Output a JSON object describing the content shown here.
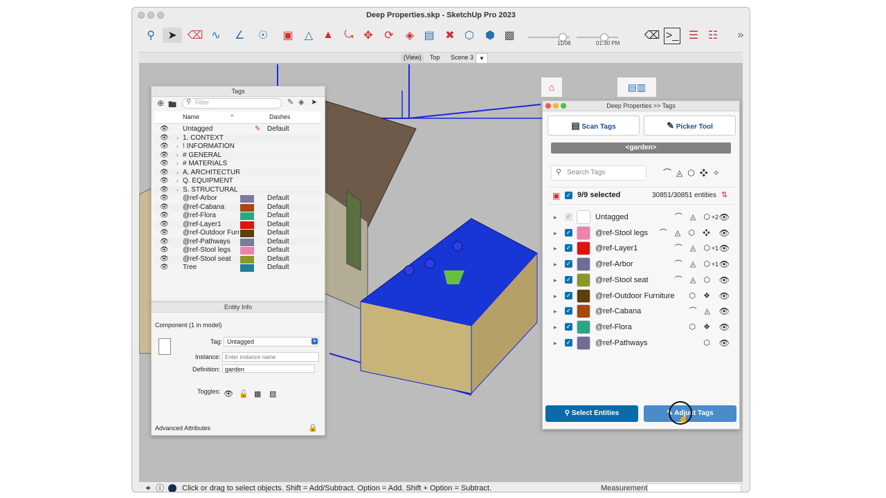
{
  "window": {
    "title": "Deep Properties.skp - SketchUp Pro 2023"
  },
  "toolbar": {
    "icons": [
      "search-icon",
      "select-icon",
      "eraser-icon",
      "freehand-icon",
      "line-icon",
      "circle-icon",
      "rectangle-icon",
      "section-icon",
      "push-pull-icon",
      "follow-me-icon",
      "move-icon",
      "rotate-icon",
      "scale-icon",
      "text-icon",
      "offset-icon",
      "component-icon",
      "tape-icon",
      "paint-icon"
    ],
    "date_label": "11/08",
    "time_label": "01:30 PM"
  },
  "scenes": {
    "tabs": [
      "(View)",
      "Top",
      "Scene 3"
    ],
    "dropdown_glyph": "▼"
  },
  "tags_panel": {
    "title": "Tags",
    "filter_placeholder": "Filter",
    "col_name": "Name",
    "col_dashes": "Dashes",
    "rows": [
      {
        "name": "Untagged",
        "color": "",
        "dash": "Default",
        "expand": false
      },
      {
        "name": "1. CONTEXT",
        "color": "",
        "dash": "",
        "expand": true
      },
      {
        "name": "! INFORMATION",
        "color": "",
        "dash": "",
        "expand": true
      },
      {
        "name": "# GENERAL",
        "color": "",
        "dash": "",
        "expand": true
      },
      {
        "name": "# MATERIALS",
        "color": "",
        "dash": "",
        "expand": true
      },
      {
        "name": "A. ARCHITECTURA",
        "color": "",
        "dash": "",
        "expand": true
      },
      {
        "name": "Q. EQUIPMENT",
        "color": "",
        "dash": "",
        "expand": true
      },
      {
        "name": "S. STRUCTURAL",
        "color": "",
        "dash": "",
        "expand": true
      },
      {
        "name": "@ref-Arbor",
        "color": "#7d7aa0",
        "dash": "Default",
        "expand": false
      },
      {
        "name": "@ref-Cabana",
        "color": "#a84710",
        "dash": "Default",
        "expand": false
      },
      {
        "name": "@ref-Flora",
        "color": "#2aa585",
        "dash": "Default",
        "expand": false
      },
      {
        "name": "@ref-Layer1",
        "color": "#e0140e",
        "dash": "Default",
        "expand": false
      },
      {
        "name": "@ref-Outdoor Furni",
        "color": "#5e3e0c",
        "dash": "Default",
        "expand": false
      },
      {
        "name": "@ref-Pathways",
        "color": "#7e7a9c",
        "dash": "Default",
        "expand": false
      },
      {
        "name": "@ref-Stool legs",
        "color": "#ef82ac",
        "dash": "Default",
        "expand": false
      },
      {
        "name": "@ref-Stool seat",
        "color": "#8c962a",
        "dash": "Default",
        "expand": false
      },
      {
        "name": "Tree",
        "color": "#1f7f99",
        "dash": "Default",
        "expand": false
      }
    ]
  },
  "entity_info": {
    "title": "Entity Info",
    "heading": "Component (1 in model)",
    "tag_label": "Tag:",
    "tag_value": "Untagged",
    "instance_label": "Instance:",
    "instance_placeholder": "Enter instance name",
    "definition_label": "Definition:",
    "definition_value": "garden",
    "toggles_label": "Toggles:",
    "advanced": "Advanced Attributes"
  },
  "deep_props": {
    "title": "Deep Properties >> Tags",
    "scan_tags": "Scan Tags",
    "picker_tool": "Picker Tool",
    "context": "<garden>",
    "search_placeholder": "Search Tags",
    "selected": "9/9 selected",
    "entities": "30851/30851 entities",
    "rows": [
      {
        "name": "Untagged",
        "color": "#ffffff",
        "icons": "⌒ ◬ ⬡",
        "extra": "+2",
        "checked": "light"
      },
      {
        "name": "@ref-Stool legs",
        "color": "#ef82ac",
        "icons": "⌒ ◬ ⬡ ❖",
        "extra": "",
        "checked": "on"
      },
      {
        "name": "@ref-Layer1",
        "color": "#e0140e",
        "icons": "⌒ ◬ ⬡",
        "extra": "+1",
        "checked": "on"
      },
      {
        "name": "@ref-Arbor",
        "color": "#6f6d96",
        "icons": "⌒ ◬ ⬡",
        "extra": "+1",
        "checked": "on"
      },
      {
        "name": "@ref-Stool seat",
        "color": "#8c962a",
        "icons": "⌒ ◬ ⬡",
        "extra": "",
        "checked": "on"
      },
      {
        "name": "@ref-Outdoor Furniture",
        "color": "#5e3e0c",
        "icons": "⬡ ❖",
        "extra": "",
        "checked": "on"
      },
      {
        "name": "@ref-Cabana",
        "color": "#a84710",
        "icons": "⌒ ◬",
        "extra": "",
        "checked": "on"
      },
      {
        "name": "@ref-Flora",
        "color": "#2aa585",
        "icons": "⬡ ❖",
        "extra": "",
        "checked": "on"
      },
      {
        "name": "@ref-Pathways",
        "color": "#6f6d96",
        "icons": "⬡",
        "extra": "",
        "checked": "on"
      }
    ],
    "select_entities": "Select Entities",
    "adjust_tags": "Adjust Tags"
  },
  "status": {
    "message": "Click or drag to select objects. Shift = Add/Subtract. Option = Add. Shift + Option = Subtract.",
    "measurements_label": "Measurements"
  }
}
